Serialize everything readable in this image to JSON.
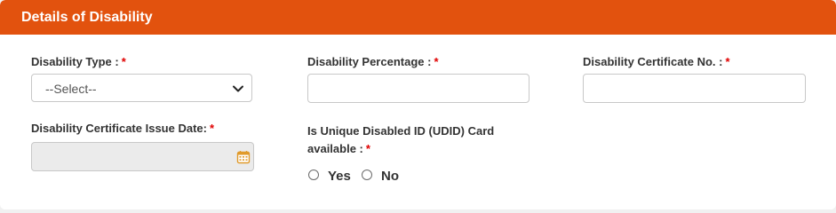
{
  "panel": {
    "title": "Details of Disability",
    "header_color": "#e2520e"
  },
  "fields": {
    "disability_type": {
      "label": "Disability Type :",
      "required_mark": "*",
      "selected": "--Select--",
      "icon": "chevron-down-icon"
    },
    "disability_percentage": {
      "label": "Disability Percentage :",
      "required_mark": "*",
      "value": ""
    },
    "certificate_no": {
      "label": "Disability Certificate No. :",
      "required_mark": "*",
      "value": ""
    },
    "issue_date": {
      "label": "Disability Certificate Issue Date:",
      "required_mark": "*",
      "value": "",
      "icon": "calendar-icon"
    },
    "udid": {
      "label": "Is Unique Disabled ID (UDID) Card available :",
      "required_mark": "*",
      "options": [
        "Yes",
        "No"
      ]
    }
  }
}
